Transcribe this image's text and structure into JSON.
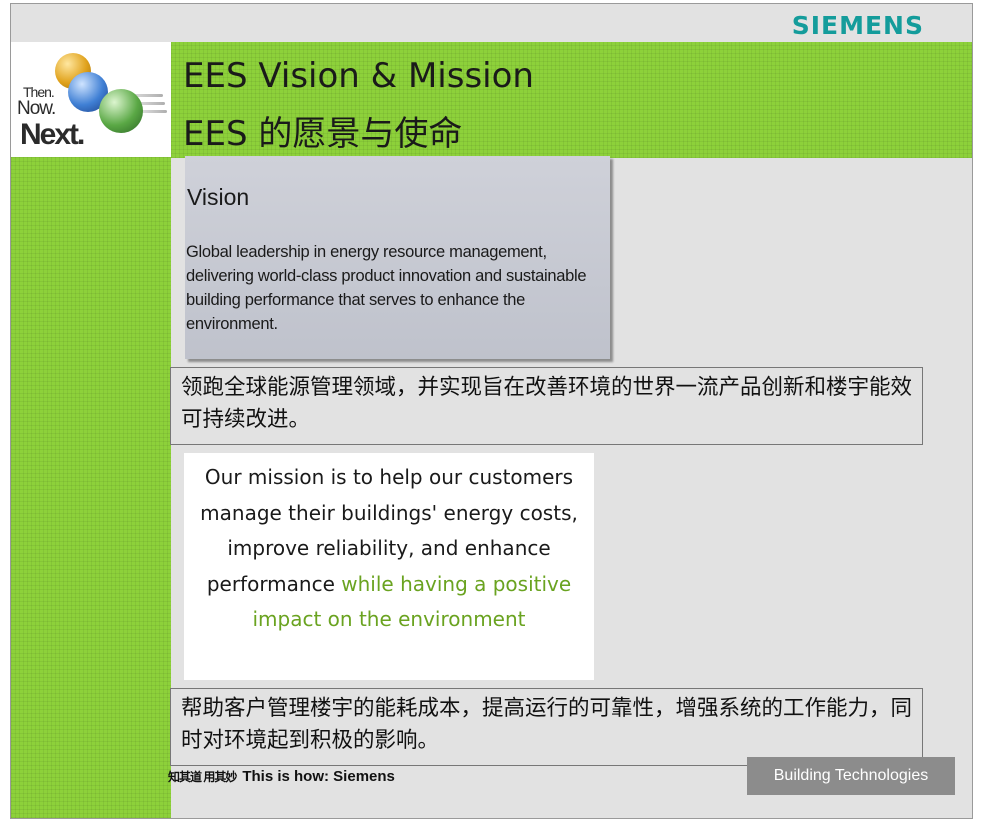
{
  "header": {
    "brand": "SIEMENS",
    "title_en": "EES Vision & Mission",
    "title_cn": "EES 的愿景与使命",
    "logo": {
      "then": "Then.",
      "now": "Now.",
      "next": "Next."
    }
  },
  "vision": {
    "heading": "Vision",
    "text": "Global leadership in energy resource management, delivering world-class product innovation and sustainable building performance that serves to enhance the environment."
  },
  "vision_cn": "领跑全球能源管理领域，并实现旨在改善环境的世界一流产品创新和楼宇能效可持续改进。",
  "mission": {
    "text": "Our mission is to help our customers manage their buildings' energy costs, improve reliability, and enhance performance",
    "highlight": "while having a positive impact on the environment"
  },
  "mission_cn": "帮助客户管理楼宇的能耗成本，提高运行的可靠性，增强系统的工作能力，同时对环境起到积极的影响。",
  "footer": {
    "tagline_cn": "知其道 用其妙",
    "tagline_en": "This is how: Siemens",
    "badge": "Building Technologies"
  },
  "colors": {
    "green": "#8dd13a",
    "brand_teal": "#149c9b",
    "highlight_green": "#6aa320",
    "slide_bg": "#e2e2e2"
  }
}
